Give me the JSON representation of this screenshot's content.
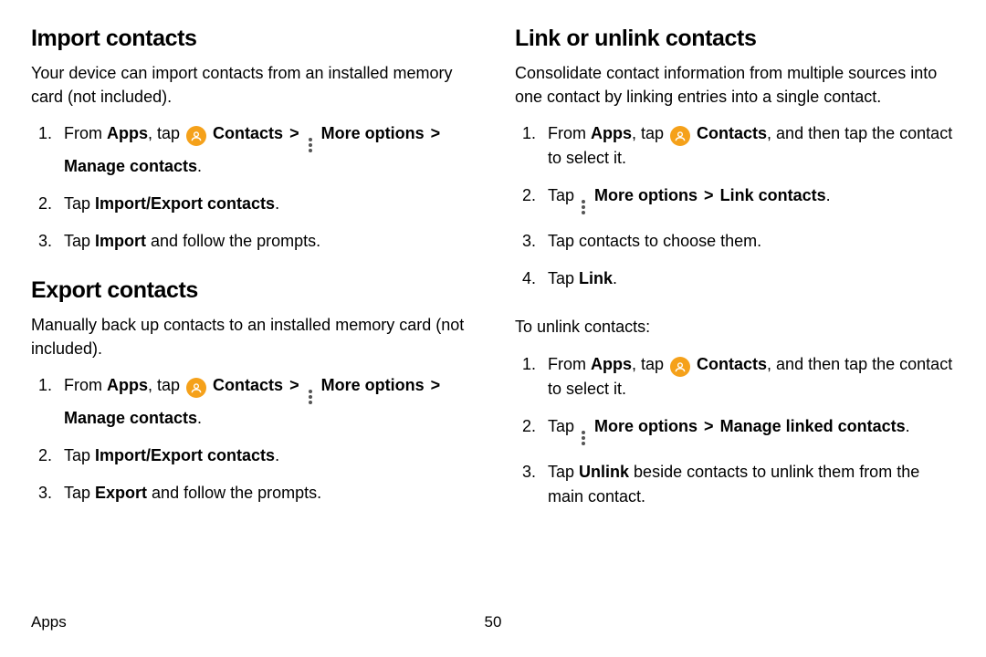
{
  "left": {
    "s1": {
      "title": "Import contacts",
      "lead": "Your device can import contacts from an installed memory card (not included).",
      "steps": {
        "s1_pre": "From ",
        "s1_apps": "Apps",
        "s1_tap": ", tap ",
        "s1_contacts": " Contacts",
        "s1_more": " More options",
        "s1_manage": "Manage contacts",
        "s1_period": ".",
        "s2_pre": "Tap ",
        "s2_b": "Import/Export contacts",
        "s2_post": ".",
        "s3_pre": "Tap ",
        "s3_b": "Import",
        "s3_post": " and follow the prompts."
      }
    },
    "s2": {
      "title": "Export contacts",
      "lead": "Manually back up contacts to an installed memory card (not included).",
      "steps": {
        "s1_pre": "From ",
        "s1_apps": "Apps",
        "s1_tap": ", tap ",
        "s1_contacts": " Contacts",
        "s1_more": " More options",
        "s1_manage": "Manage contacts",
        "s1_period": ".",
        "s2_pre": "Tap ",
        "s2_b": "Import/Export contacts",
        "s2_post": ".",
        "s3_pre": "Tap ",
        "s3_b": "Export",
        "s3_post": " and follow the prompts."
      }
    }
  },
  "right": {
    "title": "Link or unlink contacts",
    "lead": "Consolidate contact information from multiple sources into one contact by linking entries into a single contact.",
    "steps1": {
      "s1_pre": "From ",
      "s1_apps": "Apps",
      "s1_tap": ", tap ",
      "s1_contacts": " Contacts",
      "s1_post": ", and then tap the contact to select it.",
      "s2_pre": "Tap ",
      "s2_more": " More options",
      "s2_link": "Link contacts",
      "s2_post": ".",
      "s3": "Tap contacts to choose them.",
      "s4_pre": "Tap ",
      "s4_b": "Link",
      "s4_post": "."
    },
    "sub": "To unlink contacts:",
    "steps2": {
      "s1_pre": "From ",
      "s1_apps": "Apps",
      "s1_tap": ", tap ",
      "s1_contacts": " Contacts",
      "s1_post": ", and then tap the contact to select it.",
      "s2_pre": "Tap ",
      "s2_more": " More options",
      "s2_manage": "Manage linked contacts",
      "s2_post": ".",
      "s3_pre": "Tap ",
      "s3_b": "Unlink",
      "s3_post": " beside contacts to unlink them from the main contact."
    }
  },
  "footer": {
    "section": "Apps",
    "page": "50"
  },
  "glyph": {
    "chevron": ">"
  }
}
